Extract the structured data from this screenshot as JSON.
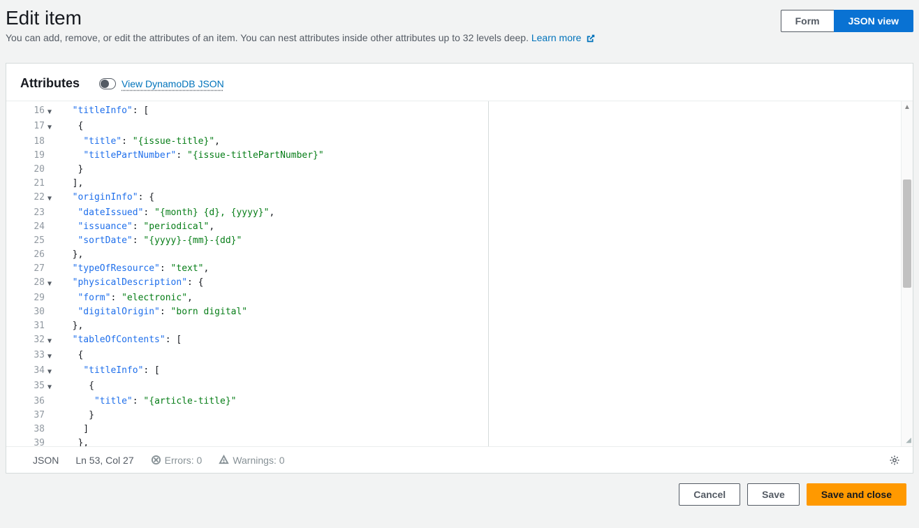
{
  "header": {
    "title": "Edit item",
    "subtitle_before_link": "You can add, remove, or edit the attributes of an item. You can nest attributes inside other attributes up to 32 levels deep. ",
    "learn_more": "Learn more"
  },
  "view_toggle": {
    "form": "Form",
    "json": "JSON view"
  },
  "panel": {
    "title": "Attributes",
    "switch_label": "View DynamoDB JSON"
  },
  "code_lines": [
    {
      "n": 16,
      "fold": true,
      "tokens": [
        [
          "p",
          "  "
        ],
        [
          "k",
          "\"titleInfo\""
        ],
        [
          "p",
          ": ["
        ]
      ]
    },
    {
      "n": 17,
      "fold": true,
      "tokens": [
        [
          "p",
          "   {"
        ]
      ]
    },
    {
      "n": 18,
      "fold": false,
      "tokens": [
        [
          "p",
          "    "
        ],
        [
          "k",
          "\"title\""
        ],
        [
          "p",
          ": "
        ],
        [
          "s",
          "\"{issue-title}\""
        ],
        [
          "p",
          ","
        ]
      ]
    },
    {
      "n": 19,
      "fold": false,
      "tokens": [
        [
          "p",
          "    "
        ],
        [
          "k",
          "\"titlePartNumber\""
        ],
        [
          "p",
          ": "
        ],
        [
          "s",
          "\"{issue-titlePartNumber}\""
        ]
      ]
    },
    {
      "n": 20,
      "fold": false,
      "tokens": [
        [
          "p",
          "   }"
        ]
      ]
    },
    {
      "n": 21,
      "fold": false,
      "tokens": [
        [
          "p",
          "  ],"
        ]
      ]
    },
    {
      "n": 22,
      "fold": true,
      "tokens": [
        [
          "p",
          "  "
        ],
        [
          "k",
          "\"originInfo\""
        ],
        [
          "p",
          ": {"
        ]
      ]
    },
    {
      "n": 23,
      "fold": false,
      "tokens": [
        [
          "p",
          "   "
        ],
        [
          "k",
          "\"dateIssued\""
        ],
        [
          "p",
          ": "
        ],
        [
          "s",
          "\"{month} {d}, {yyyy}\""
        ],
        [
          "p",
          ","
        ]
      ]
    },
    {
      "n": 24,
      "fold": false,
      "tokens": [
        [
          "p",
          "   "
        ],
        [
          "k",
          "\"issuance\""
        ],
        [
          "p",
          ": "
        ],
        [
          "s",
          "\"periodical\""
        ],
        [
          "p",
          ","
        ]
      ]
    },
    {
      "n": 25,
      "fold": false,
      "tokens": [
        [
          "p",
          "   "
        ],
        [
          "k",
          "\"sortDate\""
        ],
        [
          "p",
          ": "
        ],
        [
          "s",
          "\"{yyyy}-{mm}-{dd}\""
        ]
      ]
    },
    {
      "n": 26,
      "fold": false,
      "tokens": [
        [
          "p",
          "  },"
        ]
      ]
    },
    {
      "n": 27,
      "fold": false,
      "tokens": [
        [
          "p",
          "  "
        ],
        [
          "k",
          "\"typeOfResource\""
        ],
        [
          "p",
          ": "
        ],
        [
          "s",
          "\"text\""
        ],
        [
          "p",
          ","
        ]
      ]
    },
    {
      "n": 28,
      "fold": true,
      "tokens": [
        [
          "p",
          "  "
        ],
        [
          "k",
          "\"physicalDescription\""
        ],
        [
          "p",
          ": {"
        ]
      ]
    },
    {
      "n": 29,
      "fold": false,
      "tokens": [
        [
          "p",
          "   "
        ],
        [
          "k",
          "\"form\""
        ],
        [
          "p",
          ": "
        ],
        [
          "s",
          "\"electronic\""
        ],
        [
          "p",
          ","
        ]
      ]
    },
    {
      "n": 30,
      "fold": false,
      "tokens": [
        [
          "p",
          "   "
        ],
        [
          "k",
          "\"digitalOrigin\""
        ],
        [
          "p",
          ": "
        ],
        [
          "s",
          "\"born digital\""
        ]
      ]
    },
    {
      "n": 31,
      "fold": false,
      "tokens": [
        [
          "p",
          "  },"
        ]
      ]
    },
    {
      "n": 32,
      "fold": true,
      "tokens": [
        [
          "p",
          "  "
        ],
        [
          "k",
          "\"tableOfContents\""
        ],
        [
          "p",
          ": ["
        ]
      ]
    },
    {
      "n": 33,
      "fold": true,
      "tokens": [
        [
          "p",
          "   {"
        ]
      ]
    },
    {
      "n": 34,
      "fold": true,
      "tokens": [
        [
          "p",
          "    "
        ],
        [
          "k",
          "\"titleInfo\""
        ],
        [
          "p",
          ": ["
        ]
      ]
    },
    {
      "n": 35,
      "fold": true,
      "tokens": [
        [
          "p",
          "     {"
        ]
      ]
    },
    {
      "n": 36,
      "fold": false,
      "tokens": [
        [
          "p",
          "      "
        ],
        [
          "k",
          "\"title\""
        ],
        [
          "p",
          ": "
        ],
        [
          "s",
          "\"{article-title}\""
        ]
      ]
    },
    {
      "n": 37,
      "fold": false,
      "tokens": [
        [
          "p",
          "     }"
        ]
      ]
    },
    {
      "n": 38,
      "fold": false,
      "tokens": [
        [
          "p",
          "    ]"
        ]
      ]
    },
    {
      "n": 39,
      "fold": false,
      "tokens": [
        [
          "p",
          "   },"
        ]
      ]
    }
  ],
  "status": {
    "lang": "JSON",
    "cursor": "Ln 53, Col 27",
    "errors": "Errors: 0",
    "warnings": "Warnings: 0"
  },
  "footer": {
    "cancel": "Cancel",
    "save": "Save",
    "save_close": "Save and close"
  }
}
